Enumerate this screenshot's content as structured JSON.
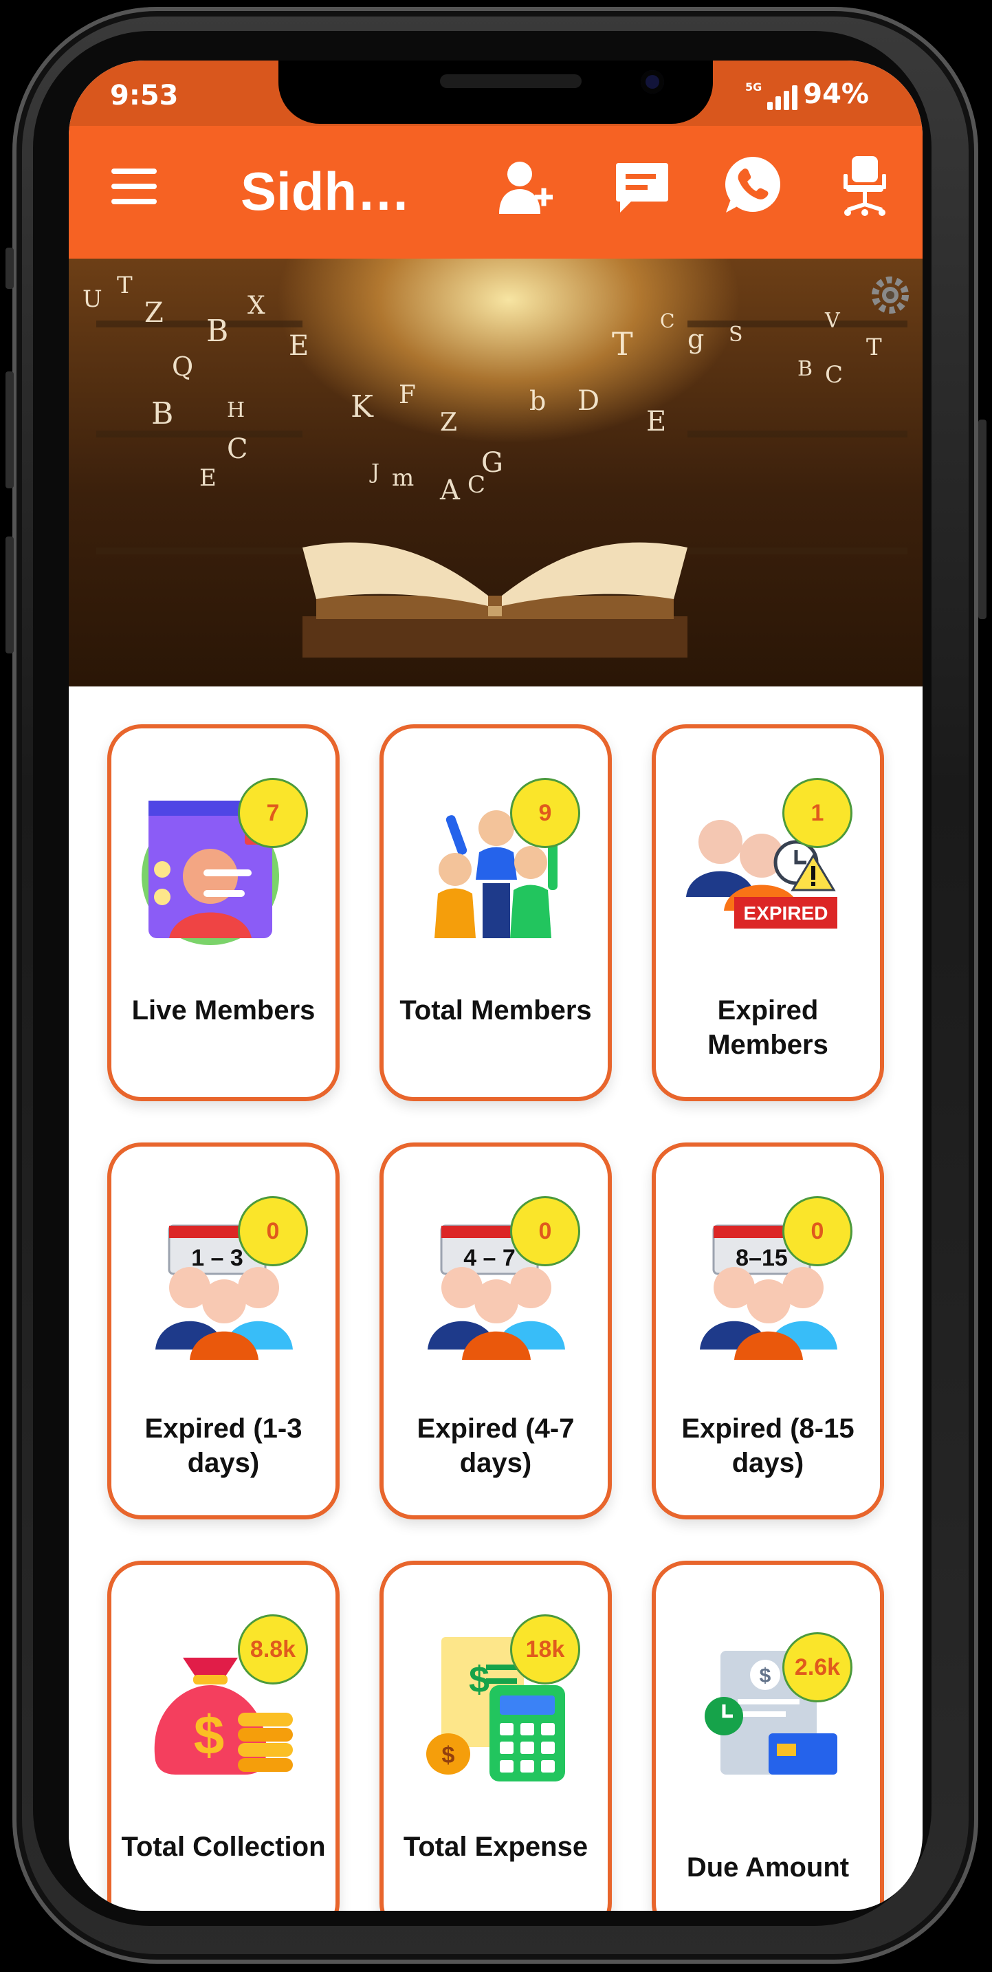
{
  "status_bar": {
    "time": "9:53",
    "network": "5G",
    "battery": "94%"
  },
  "app_bar": {
    "title": "Sidhar…",
    "icons": [
      "menu-icon",
      "add-user-icon",
      "chat-icon",
      "whatsapp-icon",
      "chair-icon"
    ]
  },
  "banner": {
    "settings_icon": "gear-icon"
  },
  "colors": {
    "primary": "#f66223",
    "status": "#d9571d",
    "card_border": "#e8652c",
    "badge": "#fae52a",
    "badge_text": "#e05a1d"
  },
  "cards": [
    {
      "label": "Live Members",
      "badge": "7",
      "icon": "live-member-icon"
    },
    {
      "label": "Total Members",
      "badge": "9",
      "icon": "group-icon"
    },
    {
      "label": "Expired Members",
      "badge": "1",
      "icon": "expired-icon"
    },
    {
      "label": "Expired (1-3 days)",
      "badge": "0",
      "icon": "calendar-group-icon",
      "range": "1 – 3"
    },
    {
      "label": "Expired (4-7 days)",
      "badge": "0",
      "icon": "calendar-group-icon",
      "range": "4 – 7"
    },
    {
      "label": "Expired (8-15 days)",
      "badge": "0",
      "icon": "calendar-group-icon",
      "range": "8–15"
    },
    {
      "label": "Total Collection",
      "badge": "8.8k",
      "icon": "money-bag-icon"
    },
    {
      "label": "Total Expense",
      "badge": "18k",
      "icon": "calculator-icon"
    },
    {
      "label": "Due Amount",
      "badge": "2.6k",
      "icon": "invoice-icon"
    }
  ]
}
